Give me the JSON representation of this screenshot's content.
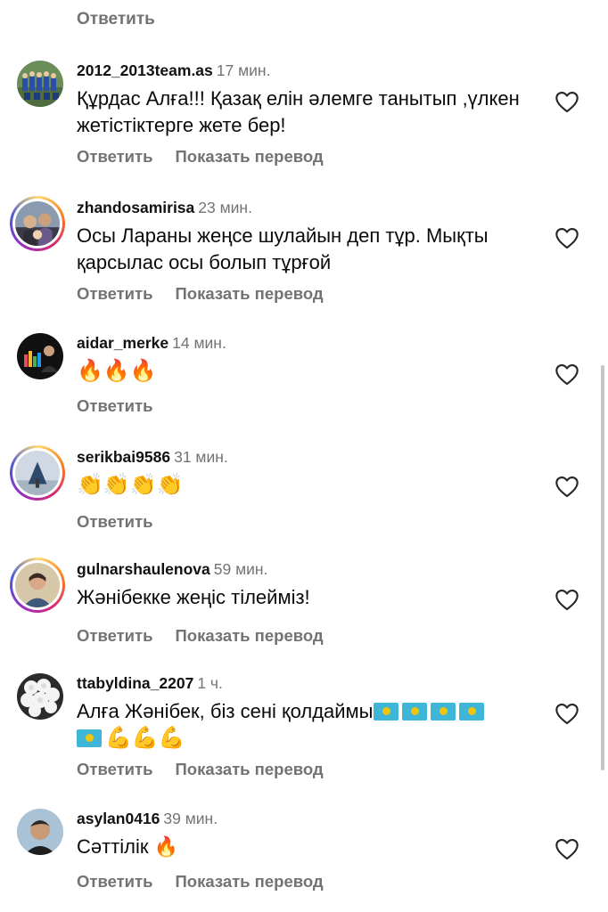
{
  "labels": {
    "reply": "Ответить",
    "translate": "Показать перевод"
  },
  "comments": [
    {
      "username": "2012_2013team.as",
      "time": "17 мин.",
      "text": "Құрдас Алға!!! Қазақ елін әлемге танытып ,үлкен жетістіктерге жете бер!",
      "has_story_ring": false,
      "show_translate": true
    },
    {
      "username": "zhandosamirisa",
      "time": "23 мин.",
      "text": "Осы Ларaны жеңсе шулайын деп тұр. Мықты қарсылас осы болып тұрғой",
      "has_story_ring": true,
      "show_translate": true
    },
    {
      "username": "aidar_merke",
      "time": "14 мин.",
      "text": "🔥🔥🔥",
      "has_story_ring": false,
      "show_translate": false
    },
    {
      "username": "serikbai9586",
      "time": "31 мин.",
      "text": "👏👏👏👏",
      "has_story_ring": true,
      "show_translate": false
    },
    {
      "username": "gulnarshaulenova",
      "time": "59 мин.",
      "text": "Жәнібекке жеңіс тілейміз!",
      "has_story_ring": true,
      "show_translate": true
    },
    {
      "username": "ttabyldina_2207",
      "time": "1 ч.",
      "text": "Алға Жәнібек, біз сені қолдаймы",
      "text_emoji_tail": "💪💪💪",
      "has_story_ring": false,
      "show_translate": true
    },
    {
      "username": "asylan0416",
      "time": "39 мин.",
      "text": "Сәттілік 🔥",
      "has_story_ring": false,
      "show_translate": true
    }
  ]
}
